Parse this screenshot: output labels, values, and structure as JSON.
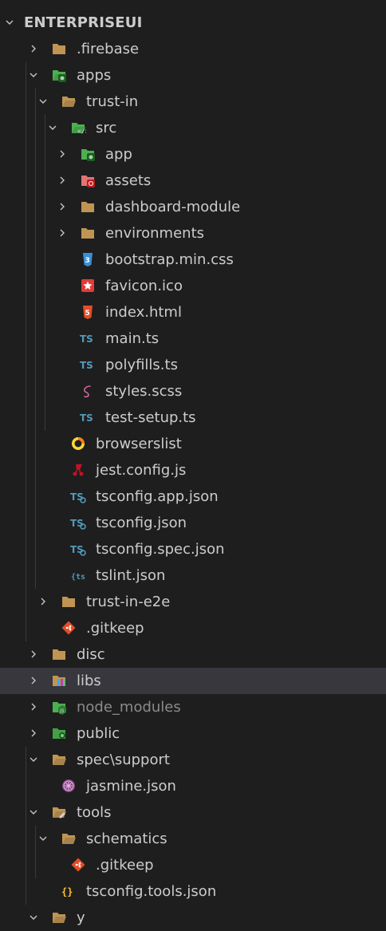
{
  "explorer": {
    "root_label": "ENTERPRISEUI",
    "items": [
      {
        "label": ".firebase",
        "icon": "folder-icon"
      },
      {
        "label": "apps",
        "icon": "folder-app-open-icon"
      },
      {
        "label": "trust-in",
        "icon": "folder-open-icon"
      },
      {
        "label": "src",
        "icon": "folder-src-open-icon"
      },
      {
        "label": "app",
        "icon": "folder-app-icon"
      },
      {
        "label": "assets",
        "icon": "folder-assets-icon"
      },
      {
        "label": "dashboard-module",
        "icon": "folder-icon"
      },
      {
        "label": "environments",
        "icon": "folder-icon"
      },
      {
        "label": "bootstrap.min.css",
        "icon": "css-file-icon"
      },
      {
        "label": "favicon.ico",
        "icon": "favicon-file-icon"
      },
      {
        "label": "index.html",
        "icon": "html-file-icon"
      },
      {
        "label": "main.ts",
        "icon": "typescript-file-icon"
      },
      {
        "label": "polyfills.ts",
        "icon": "typescript-file-icon"
      },
      {
        "label": "styles.scss",
        "icon": "sass-file-icon"
      },
      {
        "label": "test-setup.ts",
        "icon": "typescript-file-icon"
      },
      {
        "label": "browserslist",
        "icon": "browserslist-file-icon"
      },
      {
        "label": "jest.config.js",
        "icon": "jest-file-icon"
      },
      {
        "label": "tsconfig.app.json",
        "icon": "tsconfig-file-icon"
      },
      {
        "label": "tsconfig.json",
        "icon": "tsconfig-file-icon"
      },
      {
        "label": "tsconfig.spec.json",
        "icon": "tsconfig-file-icon"
      },
      {
        "label": "tslint.json",
        "icon": "tslint-file-icon"
      },
      {
        "label": "trust-in-e2e",
        "icon": "folder-icon"
      },
      {
        "label": ".gitkeep",
        "icon": "git-file-icon"
      },
      {
        "label": "disc",
        "icon": "folder-icon"
      },
      {
        "label": "libs",
        "icon": "folder-libs-icon"
      },
      {
        "label": "node_modules",
        "icon": "folder-node-icon"
      },
      {
        "label": "public",
        "icon": "folder-public-icon"
      },
      {
        "label": "spec\\support",
        "icon": "folder-open-icon"
      },
      {
        "label": "jasmine.json",
        "icon": "jasmine-file-icon"
      },
      {
        "label": "tools",
        "icon": "folder-tools-open-icon"
      },
      {
        "label": "schematics",
        "icon": "folder-open-icon"
      },
      {
        "label": ".gitkeep",
        "icon": "git-file-icon"
      },
      {
        "label": "tsconfig.tools.json",
        "icon": "json-file-icon"
      },
      {
        "label": "y",
        "icon": "folder-open-icon"
      }
    ]
  },
  "colors": {
    "background": "#1e1e1e",
    "selected_row": "#37373d",
    "text": "#cccccc",
    "dim_text": "#8b8b8b",
    "folder": "#c09553",
    "typescript": "#519aba",
    "html": "#e44d26",
    "css": "#3b8ed8",
    "sass": "#cd6799",
    "git": "#e44d26"
  }
}
